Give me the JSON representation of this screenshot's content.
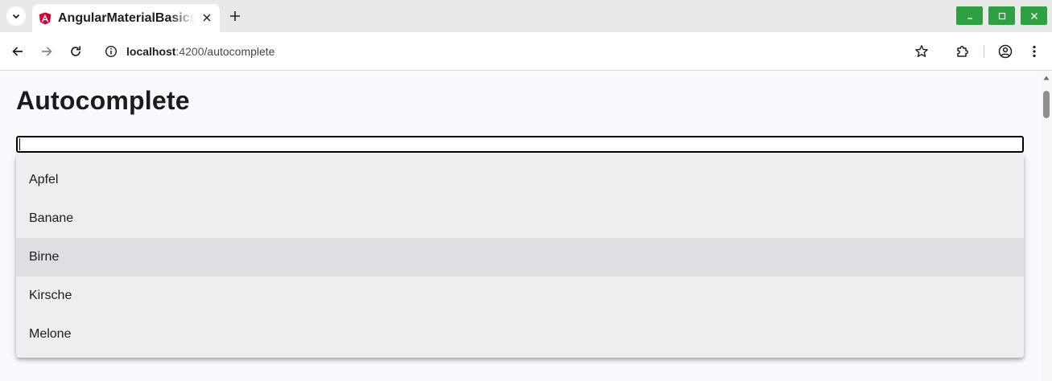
{
  "browser": {
    "tab": {
      "title": "AngularMaterialBasics"
    },
    "url": {
      "host": "localhost",
      "port": ":4200",
      "path": "/autocomplete"
    },
    "icons": {
      "tab_menu": "chevron-down-icon",
      "favicon": "angular-icon",
      "tab_close": "close-icon",
      "new_tab": "plus-icon",
      "back": "arrow-left-icon",
      "forward": "arrow-right-icon",
      "reload": "reload-icon",
      "site_info": "info-icon",
      "bookmark": "star-icon",
      "extensions": "puzzle-icon",
      "profile": "profile-icon",
      "menu": "kebab-menu-icon"
    },
    "colors": {
      "window_buttons": "#2ea043",
      "favicon": "#dd0031"
    }
  },
  "page": {
    "title": "Autocomplete",
    "input": {
      "value": "",
      "placeholder": ""
    },
    "options": [
      {
        "label": "Apfel",
        "active": false
      },
      {
        "label": "Banane",
        "active": false
      },
      {
        "label": "Birne",
        "active": true
      },
      {
        "label": "Kirsche",
        "active": false
      },
      {
        "label": "Melone",
        "active": false
      }
    ]
  }
}
